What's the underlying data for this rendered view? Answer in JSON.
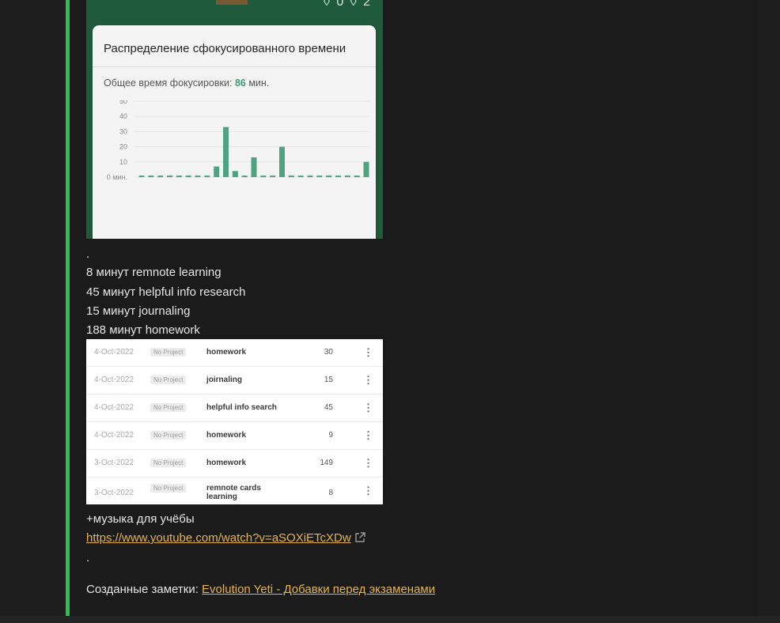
{
  "widget": {
    "top_icons": "◊ 0   ◊ 2",
    "chart_title": "Распределение сфокусированного времени",
    "total_label": "Общее время фокусировки:",
    "total_value": "86",
    "total_unit": "мин.",
    "accent": "#4ea382"
  },
  "chart_data": {
    "type": "bar",
    "title": "Распределение сфокусированного времени",
    "ylim": [
      0,
      50
    ],
    "y_ticks": [
      "50",
      "40",
      "30",
      "20",
      "10",
      "0 мин."
    ],
    "values": [
      1,
      1,
      1,
      1,
      1,
      1,
      1,
      1,
      7,
      33,
      4,
      1,
      13,
      1,
      1,
      20,
      1,
      1,
      1,
      1,
      1,
      1,
      1,
      1,
      10
    ],
    "grid": true
  },
  "notes": {
    "dot1": ".",
    "lines": [
      "8 минут remnote learning",
      "45 минут helpful info research",
      "15 минут journaling",
      "188 минут homework"
    ],
    "music": "+музыка для учёбы",
    "youtube_link": "https://www.youtube.com/watch?v=aSOXiETcXDw",
    "dot2": ".",
    "created_label": "Созданные заметки:",
    "created_link": "Evolution Yeti - Добавки перед экзаменами",
    "link_color": "#e5b54c"
  },
  "table": {
    "rows": [
      {
        "date": "4-Oct-2022",
        "project": "No Project",
        "task": "homework",
        "minutes": "30"
      },
      {
        "date": "4-Oct-2022",
        "project": "No Project",
        "task": "joirnaling",
        "minutes": "15"
      },
      {
        "date": "4-Oct-2022",
        "project": "No Project",
        "task": "helpful info search",
        "minutes": "45"
      },
      {
        "date": "4-Oct-2022",
        "project": "No Project",
        "task": "homework",
        "minutes": "9"
      },
      {
        "date": "3-Oct-2022",
        "project": "No Project",
        "task": "homework",
        "minutes": "149"
      },
      {
        "date": "3-Oct-2022",
        "project": "No Project",
        "task": "remnote cards learning",
        "minutes": "8"
      }
    ],
    "menu_icon": "⋮"
  }
}
